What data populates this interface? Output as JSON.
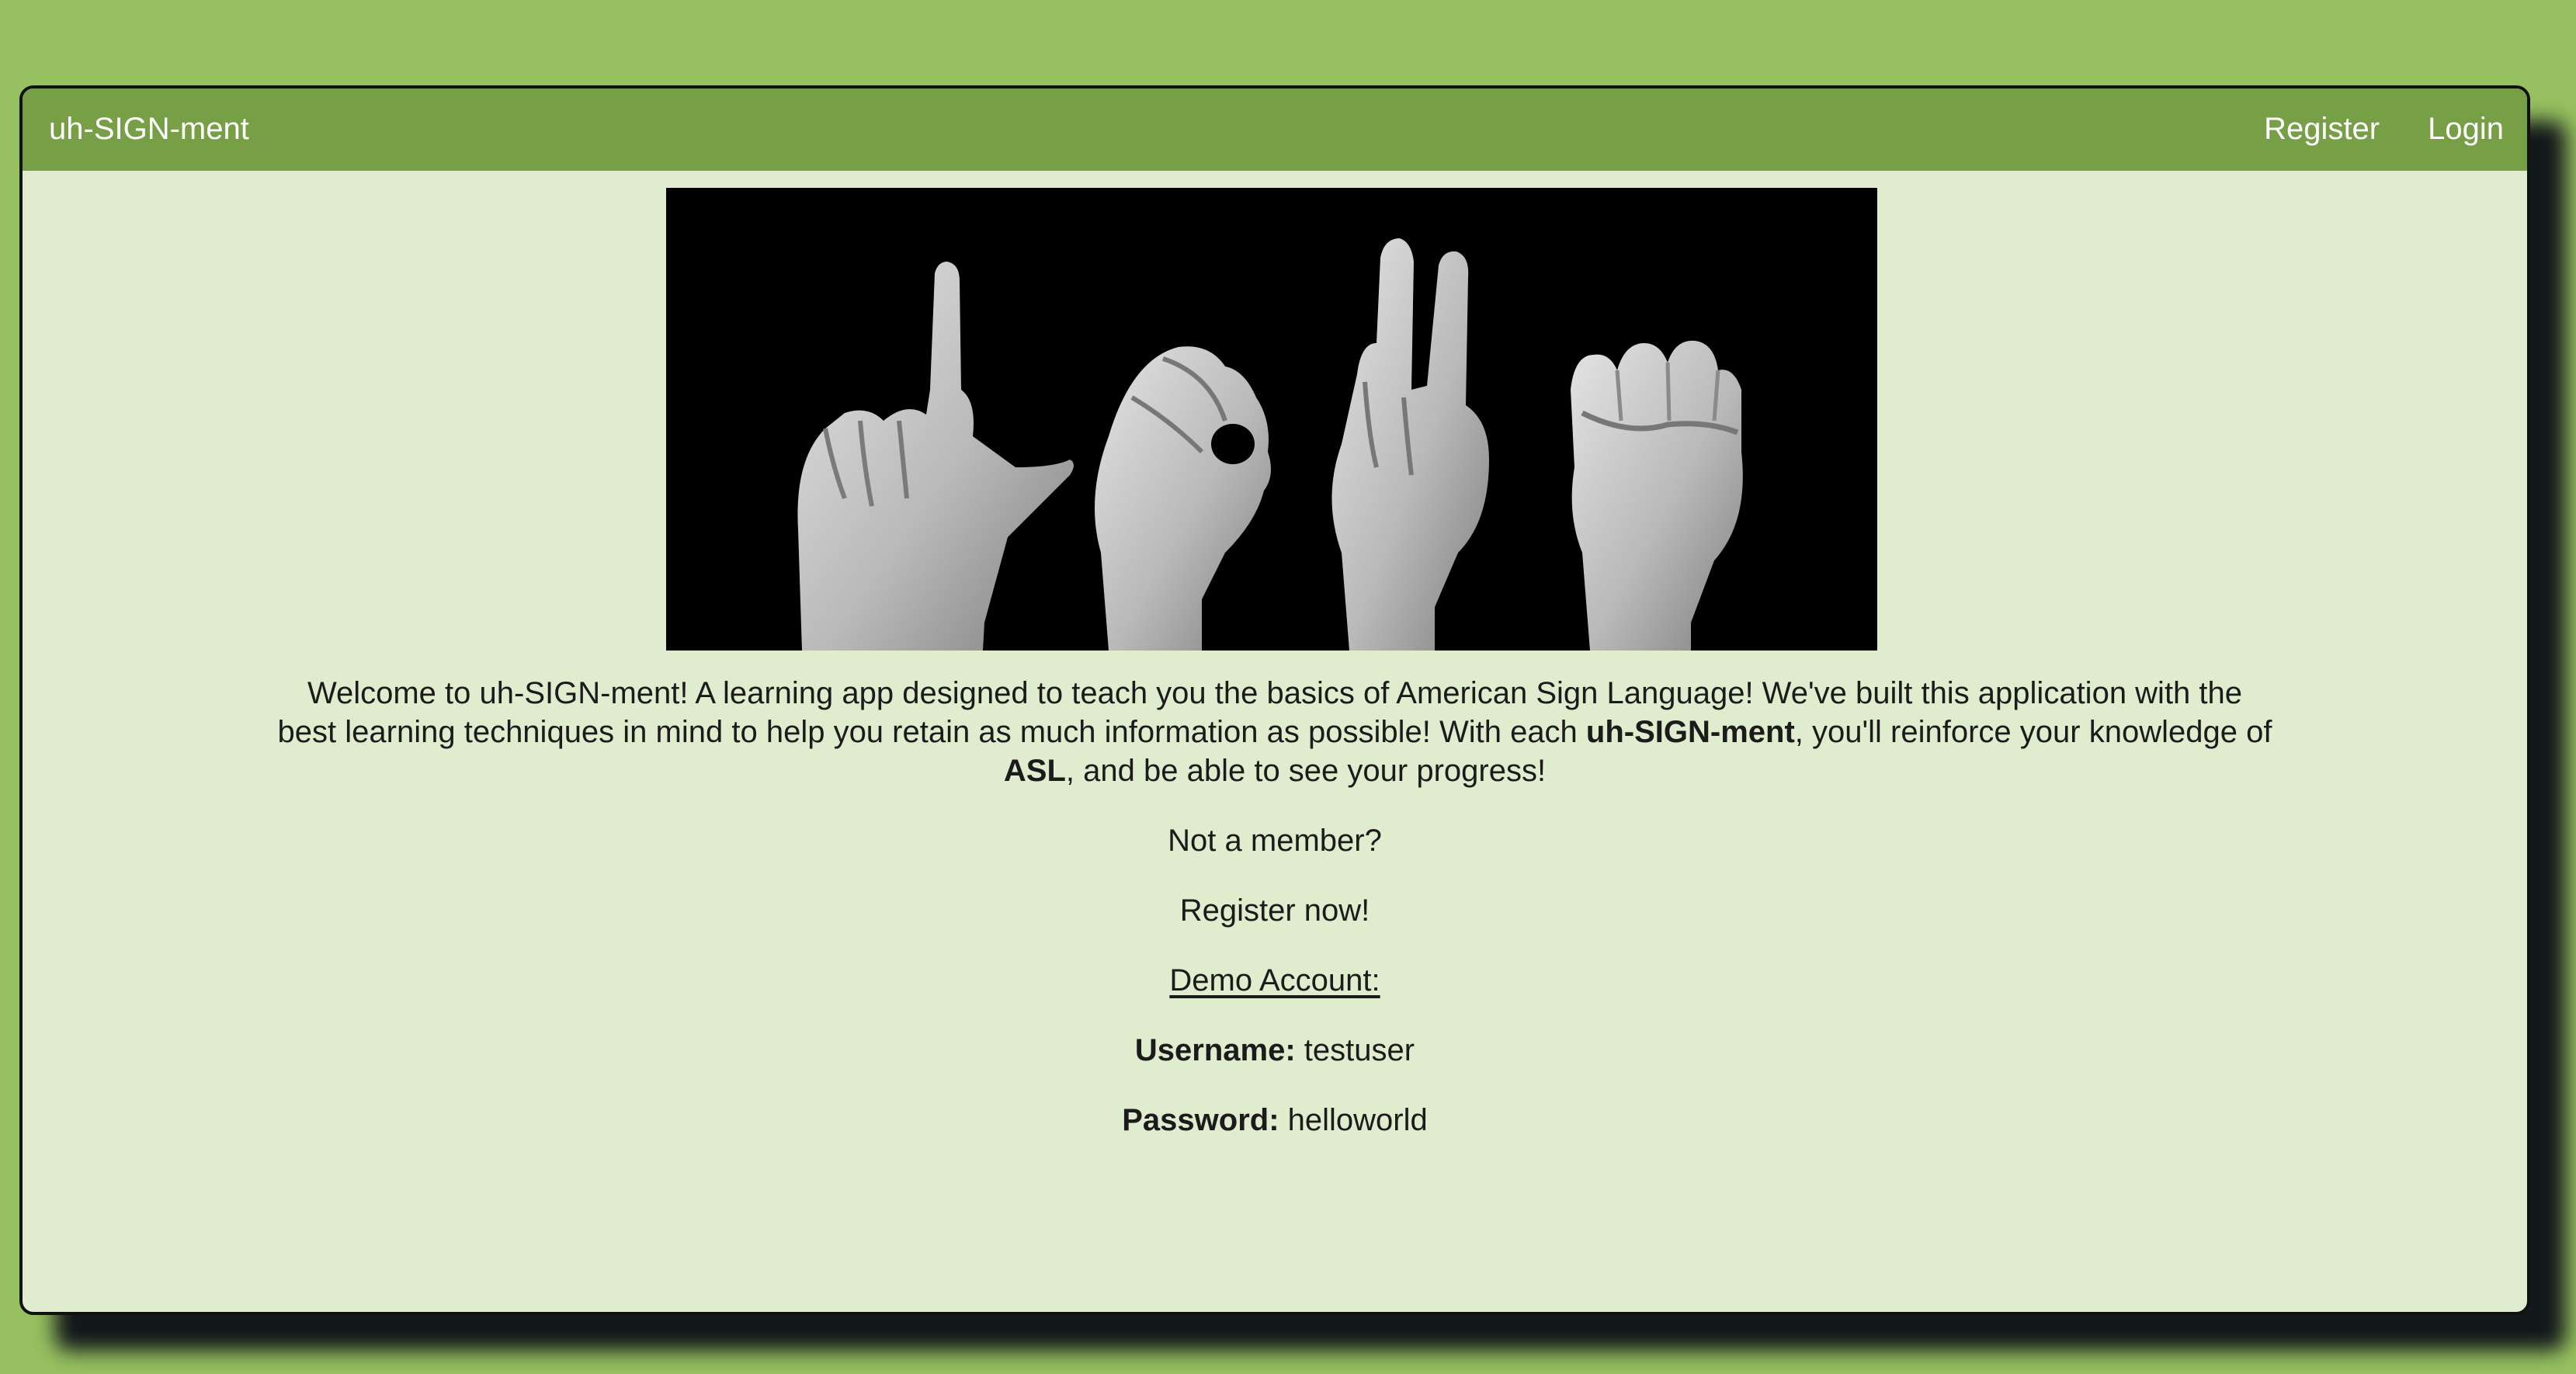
{
  "navbar": {
    "brand": "uh-SIGN-ment",
    "links": [
      {
        "label": "Register"
      },
      {
        "label": "Login"
      }
    ]
  },
  "hero": {
    "description": "Hands spelling letters in American Sign Language"
  },
  "welcome": {
    "line1": "Welcome to uh-SIGN-ment! A learning app designed to teach you the basics of American Sign Language! We've built this application with the",
    "line2_before": "best learning techniques in mind to help you retain as much information as possible! With each ",
    "line2_bold": "uh-SIGN-ment",
    "line2_after": ", you'll reinforce your knowledge of",
    "line3_bold": "ASL",
    "line3_after": ", and be able to see your progress!"
  },
  "member_prompt": "Not a member?",
  "register_prompt": "Register now!",
  "demo": {
    "heading": "Demo Account:",
    "username_label": "Username:",
    "username_value": " testuser",
    "password_label": "Password:",
    "password_value": " helloworld"
  },
  "colors": {
    "page_background": "#97c160",
    "navbar": "#779f46",
    "content_background": "#e0ecce",
    "text": "#1b1b1b",
    "nav_text": "#ffffff"
  }
}
